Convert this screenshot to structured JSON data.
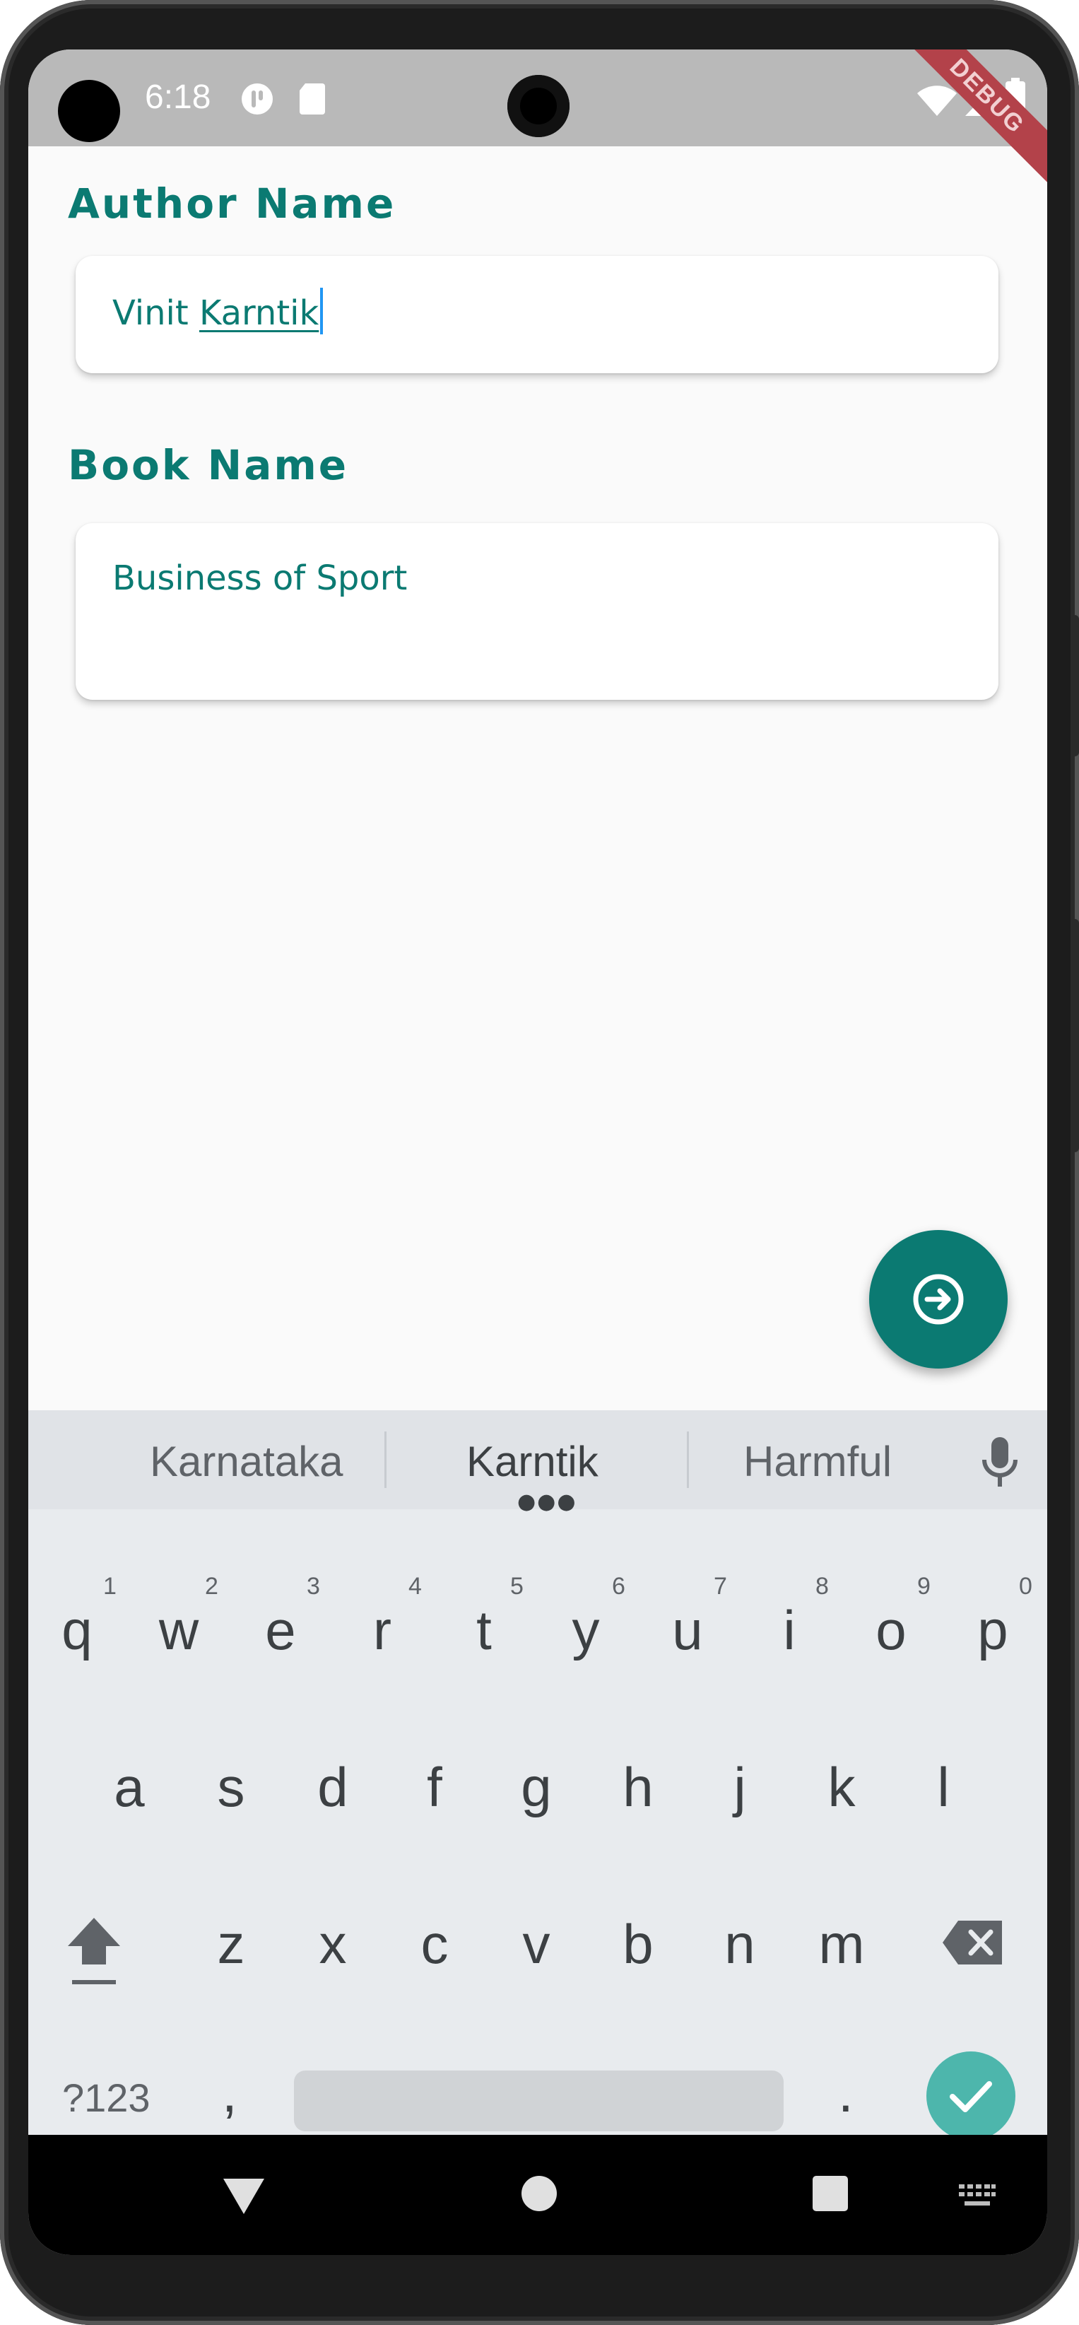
{
  "status_bar": {
    "time": "6:18",
    "debug_banner": "DEBUG"
  },
  "form": {
    "author_label": "Author Name",
    "author_value_first": "Vinit ",
    "author_value_composing": "Karntik",
    "book_label": "Book Name",
    "book_value": "Business of Sport"
  },
  "fab": {
    "icon": "arrow-right-circle-icon"
  },
  "keyboard": {
    "suggestions": [
      "Karnataka",
      "Karntik",
      "Harmful"
    ],
    "row1": [
      "q",
      "w",
      "e",
      "r",
      "t",
      "y",
      "u",
      "i",
      "o",
      "p"
    ],
    "row1_hints": [
      "1",
      "2",
      "3",
      "4",
      "5",
      "6",
      "7",
      "8",
      "9",
      "0"
    ],
    "row2": [
      "a",
      "s",
      "d",
      "f",
      "g",
      "h",
      "j",
      "k",
      "l"
    ],
    "row3": [
      "z",
      "x",
      "c",
      "v",
      "b",
      "n",
      "m"
    ],
    "symbols_label": "?123",
    "comma_label": ",",
    "period_label": "."
  },
  "colors": {
    "accent": "#0b7a72",
    "enter_key": "#4db6ac",
    "caret": "#2196f3",
    "debug": "#b3424a"
  }
}
